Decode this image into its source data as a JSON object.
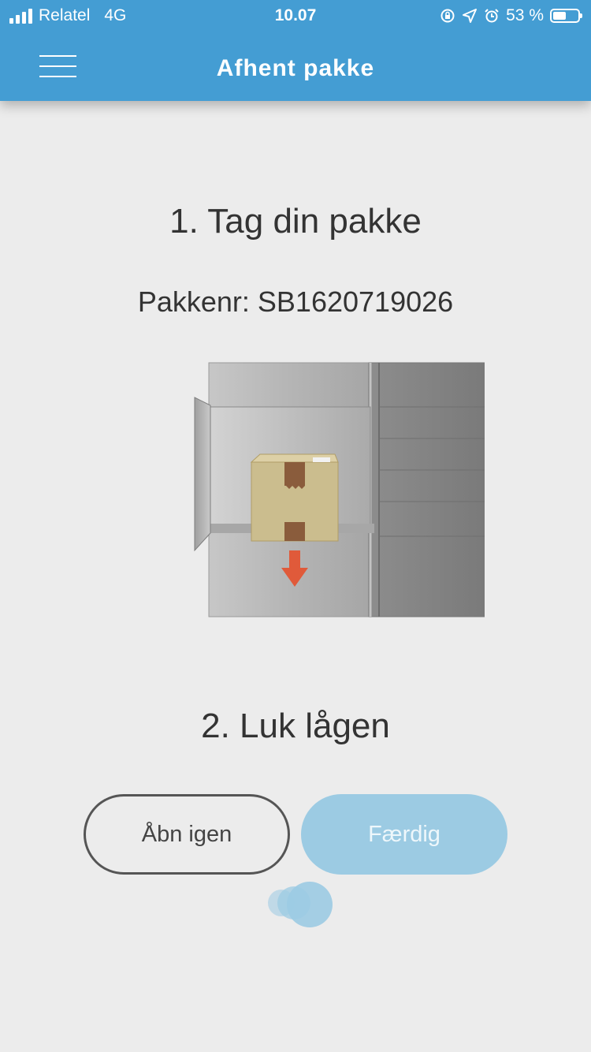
{
  "status_bar": {
    "carrier": "Relatel",
    "network": "4G",
    "time": "10.07",
    "battery": "53 %",
    "battery_level": 0.53
  },
  "header": {
    "title": "Afhent pakke",
    "menu_icon": "hamburger-menu-icon"
  },
  "main": {
    "step1_title": "1. Tag din pakke",
    "package_number": "Pakkenr: SB1620719026",
    "illustration": "parcel-locker-illustration",
    "step2_title": "2. Luk lågen",
    "reopen_button": "Åbn igen",
    "done_button": "Færdig"
  },
  "colors": {
    "primary": "#449dd3",
    "button_disabled": "#9ccbe3",
    "arrow": "#e05a3a"
  }
}
